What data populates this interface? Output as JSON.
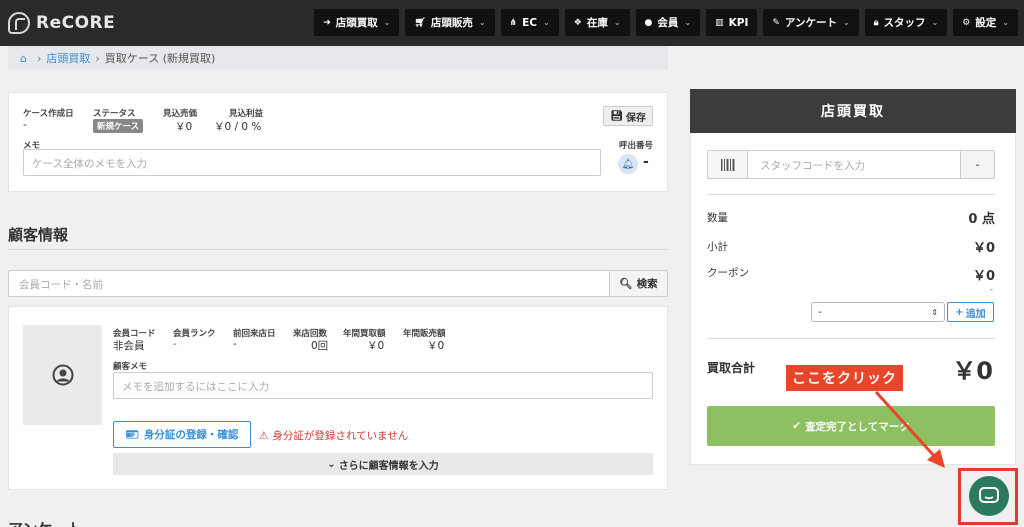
{
  "app": {
    "logo_text": "ReCORE"
  },
  "nav": [
    {
      "label": "店頭買取",
      "icon": "login-icon"
    },
    {
      "label": "店頭販売",
      "icon": "cart-icon"
    },
    {
      "label": "EC",
      "icon": "sitemap-icon"
    },
    {
      "label": "在庫",
      "icon": "cubes-icon"
    },
    {
      "label": "会員",
      "icon": "user-icon"
    },
    {
      "label": "KPI",
      "icon": "bar-chart-icon"
    },
    {
      "label": "アンケート",
      "icon": "edit-icon"
    },
    {
      "label": "スタッフ",
      "icon": "lock-icon"
    },
    {
      "label": "設定",
      "icon": "gear-icon"
    }
  ],
  "breadcrumb": {
    "link": "店頭買取",
    "current": "買取ケース (新規買取)"
  },
  "case": {
    "created_label": "ケース作成日",
    "created_value": "-",
    "status_label": "ステータス",
    "status_value": "新規ケース",
    "est_sales_label": "見込売価",
    "est_sales_value": "￥0",
    "est_profit_label": "見込利益",
    "est_profit_value": "￥0 / 0 %",
    "save_label": "保存",
    "memo_label": "メモ",
    "memo_placeholder": "ケース全体のメモを入力",
    "call_label": "呼出番号",
    "call_value": "-"
  },
  "customer": {
    "section_title": "顧客情報",
    "search_placeholder": "会員コード・名前",
    "search_button": "検索",
    "fields": [
      {
        "label": "会員コード",
        "value": "非会員"
      },
      {
        "label": "会員ランク",
        "value": "-"
      },
      {
        "label": "前回来店日",
        "value": "-"
      },
      {
        "label": "来店回数",
        "value": "0回"
      },
      {
        "label": "年間買取額",
        "value": "￥0"
      },
      {
        "label": "年間販売額",
        "value": "￥0"
      }
    ],
    "memo_label": "顧客メモ",
    "memo_placeholder": "メモを追加するにはここに入力",
    "id_button": "身分証の登録・確認",
    "id_warning": "身分証が登録されていません",
    "more_button": "さらに顧客情報を入力"
  },
  "next_section_title": "アンケート",
  "register": {
    "title": "店頭買取",
    "staff_placeholder": "スタッフコードを入力",
    "staff_button": "-",
    "qty_label": "数量",
    "qty_value": "0 点",
    "subtotal_label": "小計",
    "subtotal_value": "￥0",
    "coupon_label": "クーポン",
    "coupon_value": "￥0",
    "coupon_sub": "-",
    "coupon_select": "-",
    "add_button": "追加",
    "total_label": "買取合計",
    "total_value": "￥0",
    "complete_button": "査定完了としてマーク"
  },
  "annotation": {
    "callout": "ここをクリック"
  },
  "colors": {
    "accent": "#3a8fd4",
    "complete": "#8cc061",
    "callout": "#e8452a",
    "chat": "#2c7a5e"
  }
}
